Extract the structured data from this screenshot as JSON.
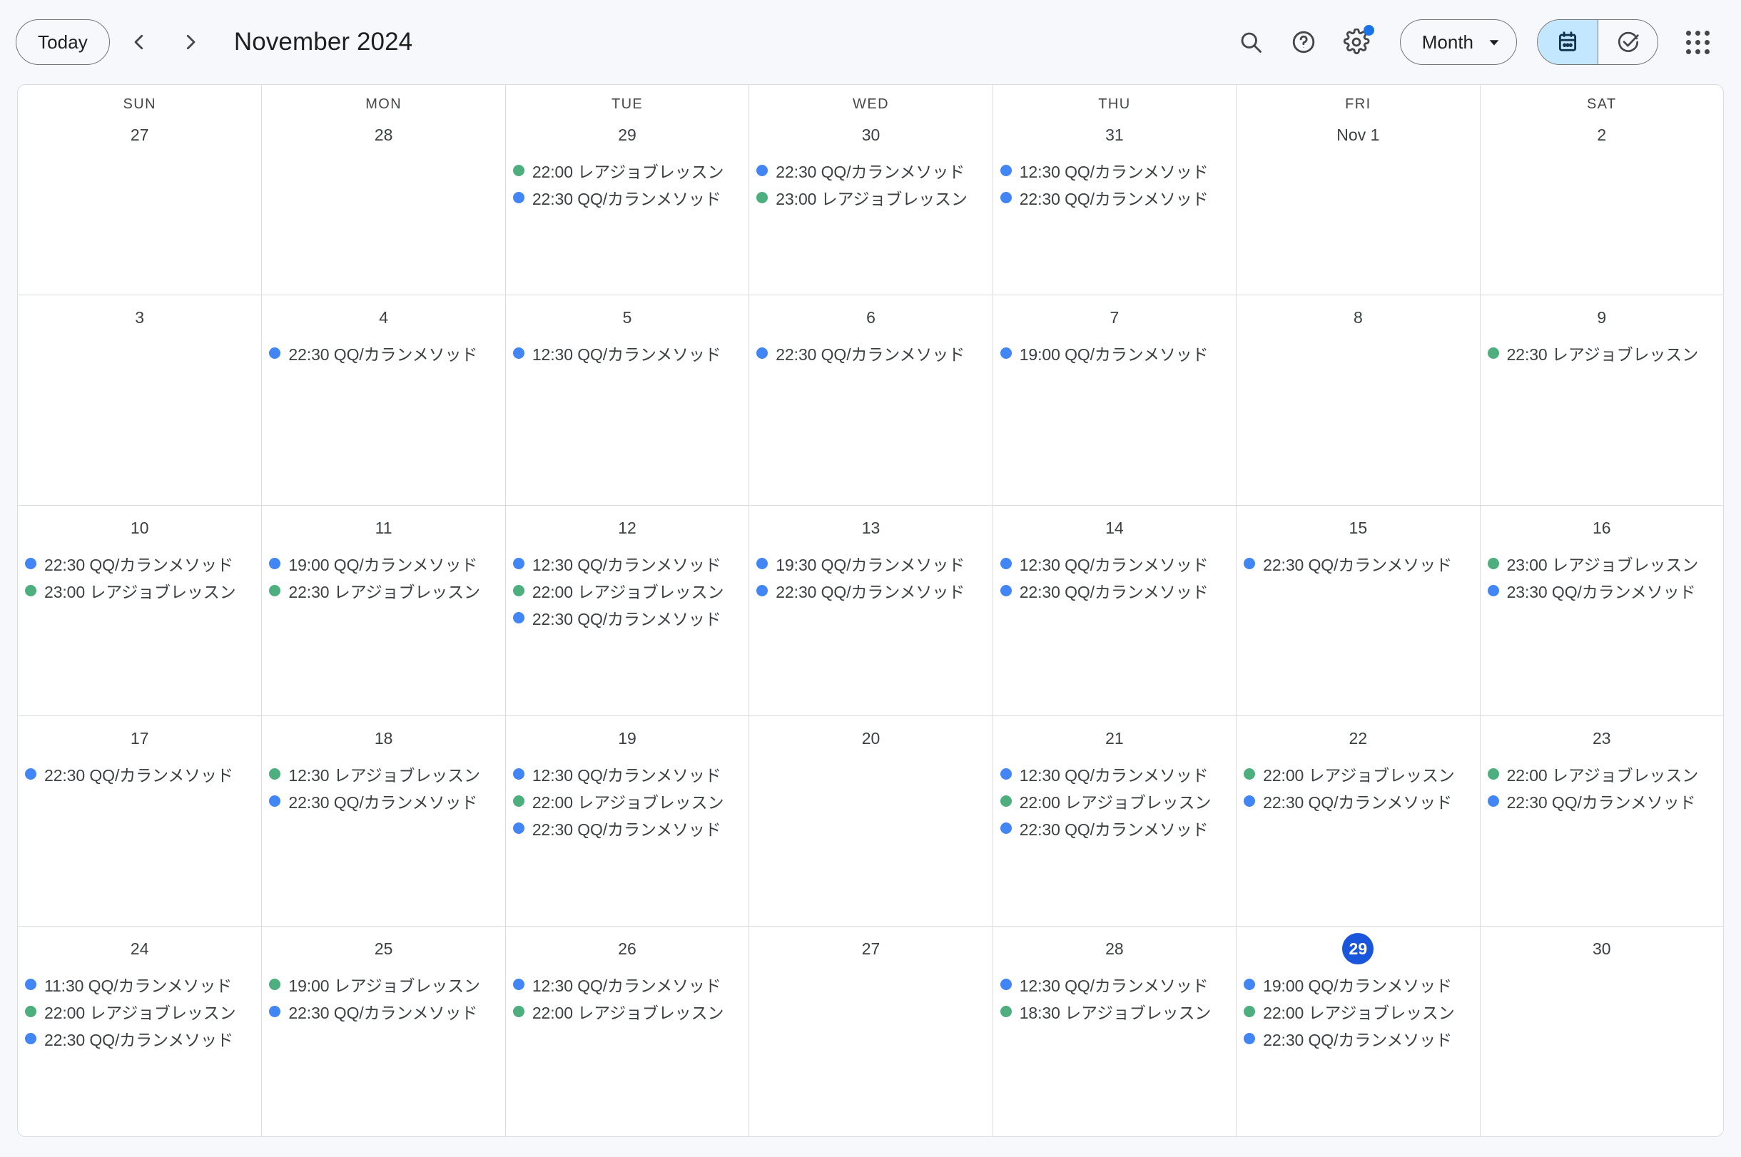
{
  "header": {
    "today_label": "Today",
    "prev_label": "‹",
    "next_label": "›",
    "title": "November 2024",
    "view_label": "Month",
    "icons": {
      "search": "search-icon",
      "help": "help-icon",
      "settings": "gear-icon",
      "calendar_mode": "calendar-icon",
      "tasks_mode": "tasks-check-icon",
      "apps": "apps-grid-icon"
    }
  },
  "colors": {
    "page_background": "#f6f8fc",
    "grid_line": "#dadce0",
    "today_badge": "#1a56db",
    "event_blue": "#4285f4",
    "event_green": "#4caf7d",
    "accent": "#1a73e8",
    "toggle_active": "#c2e7ff"
  },
  "calendar": {
    "day_headers": [
      "SUN",
      "MON",
      "TUE",
      "WED",
      "THU",
      "FRI",
      "SAT"
    ],
    "weeks": [
      [
        {
          "date": "27",
          "today": false,
          "events": []
        },
        {
          "date": "28",
          "today": false,
          "events": []
        },
        {
          "date": "29",
          "today": false,
          "events": [
            {
              "time": "22:00",
              "title": "レアジョブレッスン",
              "color": "green"
            },
            {
              "time": "22:30",
              "title": "QQ/カランメソッド",
              "color": "blue"
            }
          ]
        },
        {
          "date": "30",
          "today": false,
          "events": [
            {
              "time": "22:30",
              "title": "QQ/カランメソッド",
              "color": "blue"
            },
            {
              "time": "23:00",
              "title": "レアジョブレッスン",
              "color": "green"
            }
          ]
        },
        {
          "date": "31",
          "today": false,
          "events": [
            {
              "time": "12:30",
              "title": "QQ/カランメソッド",
              "color": "blue"
            },
            {
              "time": "22:30",
              "title": "QQ/カランメソッド",
              "color": "blue"
            }
          ]
        },
        {
          "date": "Nov 1",
          "today": false,
          "events": []
        },
        {
          "date": "2",
          "today": false,
          "events": []
        }
      ],
      [
        {
          "date": "3",
          "today": false,
          "events": []
        },
        {
          "date": "4",
          "today": false,
          "events": [
            {
              "time": "22:30",
              "title": "QQ/カランメソッド",
              "color": "blue"
            }
          ]
        },
        {
          "date": "5",
          "today": false,
          "events": [
            {
              "time": "12:30",
              "title": "QQ/カランメソッド",
              "color": "blue"
            }
          ]
        },
        {
          "date": "6",
          "today": false,
          "events": [
            {
              "time": "22:30",
              "title": "QQ/カランメソッド",
              "color": "blue"
            }
          ]
        },
        {
          "date": "7",
          "today": false,
          "events": [
            {
              "time": "19:00",
              "title": "QQ/カランメソッド",
              "color": "blue"
            }
          ]
        },
        {
          "date": "8",
          "today": false,
          "events": []
        },
        {
          "date": "9",
          "today": false,
          "events": [
            {
              "time": "22:30",
              "title": "レアジョブレッスン",
              "color": "green"
            }
          ]
        }
      ],
      [
        {
          "date": "10",
          "today": false,
          "events": [
            {
              "time": "22:30",
              "title": "QQ/カランメソッド",
              "color": "blue"
            },
            {
              "time": "23:00",
              "title": "レアジョブレッスン",
              "color": "green"
            }
          ]
        },
        {
          "date": "11",
          "today": false,
          "events": [
            {
              "time": "19:00",
              "title": "QQ/カランメソッド",
              "color": "blue"
            },
            {
              "time": "22:30",
              "title": "レアジョブレッスン",
              "color": "green"
            }
          ]
        },
        {
          "date": "12",
          "today": false,
          "events": [
            {
              "time": "12:30",
              "title": "QQ/カランメソッド",
              "color": "blue"
            },
            {
              "time": "22:00",
              "title": "レアジョブレッスン",
              "color": "green"
            },
            {
              "time": "22:30",
              "title": "QQ/カランメソッド",
              "color": "blue"
            }
          ]
        },
        {
          "date": "13",
          "today": false,
          "events": [
            {
              "time": "19:30",
              "title": "QQ/カランメソッド",
              "color": "blue"
            },
            {
              "time": "22:30",
              "title": "QQ/カランメソッド",
              "color": "blue"
            }
          ]
        },
        {
          "date": "14",
          "today": false,
          "events": [
            {
              "time": "12:30",
              "title": "QQ/カランメソッド",
              "color": "blue"
            },
            {
              "time": "22:30",
              "title": "QQ/カランメソッド",
              "color": "blue"
            }
          ]
        },
        {
          "date": "15",
          "today": false,
          "events": [
            {
              "time": "22:30",
              "title": "QQ/カランメソッド",
              "color": "blue"
            }
          ]
        },
        {
          "date": "16",
          "today": false,
          "events": [
            {
              "time": "23:00",
              "title": "レアジョブレッスン",
              "color": "green"
            },
            {
              "time": "23:30",
              "title": "QQ/カランメソッド",
              "color": "blue"
            }
          ]
        }
      ],
      [
        {
          "date": "17",
          "today": false,
          "events": [
            {
              "time": "22:30",
              "title": "QQ/カランメソッド",
              "color": "blue"
            }
          ]
        },
        {
          "date": "18",
          "today": false,
          "events": [
            {
              "time": "12:30",
              "title": "レアジョブレッスン",
              "color": "green"
            },
            {
              "time": "22:30",
              "title": "QQ/カランメソッド",
              "color": "blue"
            }
          ]
        },
        {
          "date": "19",
          "today": false,
          "events": [
            {
              "time": "12:30",
              "title": "QQ/カランメソッド",
              "color": "blue"
            },
            {
              "time": "22:00",
              "title": "レアジョブレッスン",
              "color": "green"
            },
            {
              "time": "22:30",
              "title": "QQ/カランメソッド",
              "color": "blue"
            }
          ]
        },
        {
          "date": "20",
          "today": false,
          "events": []
        },
        {
          "date": "21",
          "today": false,
          "events": [
            {
              "time": "12:30",
              "title": "QQ/カランメソッド",
              "color": "blue"
            },
            {
              "time": "22:00",
              "title": "レアジョブレッスン",
              "color": "green"
            },
            {
              "time": "22:30",
              "title": "QQ/カランメソッド",
              "color": "blue"
            }
          ]
        },
        {
          "date": "22",
          "today": false,
          "events": [
            {
              "time": "22:00",
              "title": "レアジョブレッスン",
              "color": "green"
            },
            {
              "time": "22:30",
              "title": "QQ/カランメソッド",
              "color": "blue"
            }
          ]
        },
        {
          "date": "23",
          "today": false,
          "events": [
            {
              "time": "22:00",
              "title": "レアジョブレッスン",
              "color": "green"
            },
            {
              "time": "22:30",
              "title": "QQ/カランメソッド",
              "color": "blue"
            }
          ]
        }
      ],
      [
        {
          "date": "24",
          "today": false,
          "events": [
            {
              "time": "11:30",
              "title": "QQ/カランメソッド",
              "color": "blue"
            },
            {
              "time": "22:00",
              "title": "レアジョブレッスン",
              "color": "green"
            },
            {
              "time": "22:30",
              "title": "QQ/カランメソッド",
              "color": "blue"
            }
          ]
        },
        {
          "date": "25",
          "today": false,
          "events": [
            {
              "time": "19:00",
              "title": "レアジョブレッスン",
              "color": "green"
            },
            {
              "time": "22:30",
              "title": "QQ/カランメソッド",
              "color": "blue"
            }
          ]
        },
        {
          "date": "26",
          "today": false,
          "events": [
            {
              "time": "12:30",
              "title": "QQ/カランメソッド",
              "color": "blue"
            },
            {
              "time": "22:00",
              "title": "レアジョブレッスン",
              "color": "green"
            }
          ]
        },
        {
          "date": "27",
          "today": false,
          "events": []
        },
        {
          "date": "28",
          "today": false,
          "events": [
            {
              "time": "12:30",
              "title": "QQ/カランメソッド",
              "color": "blue"
            },
            {
              "time": "18:30",
              "title": "レアジョブレッスン",
              "color": "green"
            }
          ]
        },
        {
          "date": "29",
          "today": true,
          "events": [
            {
              "time": "19:00",
              "title": "QQ/カランメソッド",
              "color": "blue"
            },
            {
              "time": "22:00",
              "title": "レアジョブレッスン",
              "color": "green"
            },
            {
              "time": "22:30",
              "title": "QQ/カランメソッド",
              "color": "blue"
            }
          ]
        },
        {
          "date": "30",
          "today": false,
          "events": []
        }
      ]
    ]
  }
}
